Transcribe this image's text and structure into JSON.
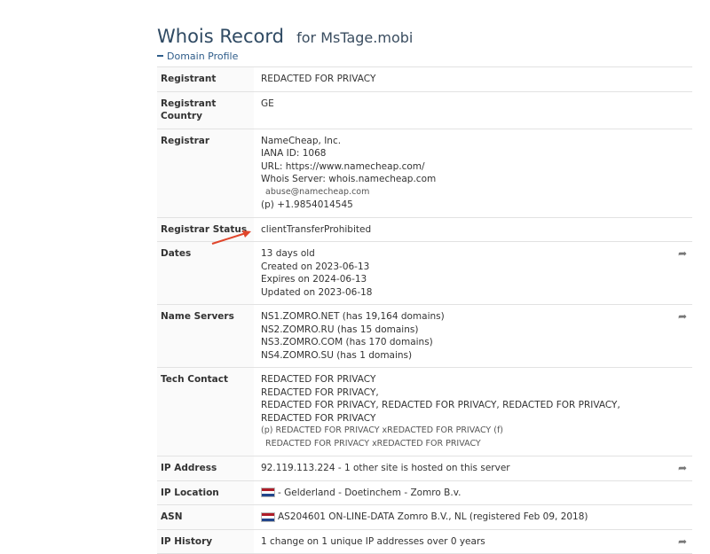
{
  "page": {
    "title": "Whois Record",
    "subtitle": "for MsTage.mobi",
    "section": "Domain Profile"
  },
  "rows": {
    "registrant": {
      "key": "Registrant",
      "value": "REDACTED FOR PRIVACY"
    },
    "registrant_country": {
      "key": "Registrant Country",
      "value": "GE"
    },
    "registrar": {
      "key": "Registrar",
      "name": "NameCheap, Inc.",
      "iana": "IANA ID: 1068",
      "url": "URL: https://www.namecheap.com/",
      "whois": "Whois Server: whois.namecheap.com",
      "email": "abuse@namecheap.com",
      "phone_label": "(p)",
      "phone": "+1.9854014545"
    },
    "registrar_status": {
      "key": "Registrar Status",
      "value": "clientTransferProhibited"
    },
    "dates": {
      "key": "Dates",
      "age": "13 days old",
      "created": "Created on 2023-06-13",
      "expires": "Expires on 2024-06-13",
      "updated": "Updated on 2023-06-18"
    },
    "name_servers": {
      "key": "Name Servers",
      "ns1": "NS1.ZOMRO.NET (has 19,164 domains)",
      "ns2": "NS2.ZOMRO.RU (has 15 domains)",
      "ns3": "NS3.ZOMRO.COM (has 170 domains)",
      "ns4": "NS4.ZOMRO.SU (has 1 domains)"
    },
    "tech_contact": {
      "key": "Tech Contact",
      "l1": "REDACTED FOR PRIVACY",
      "l2": "REDACTED FOR PRIVACY,",
      "l3": "REDACTED FOR PRIVACY, REDACTED FOR PRIVACY, REDACTED FOR PRIVACY, REDACTED FOR PRIVACY",
      "phone_label": "(p)",
      "phone": "REDACTED FOR PRIVACY xREDACTED FOR PRIVACY",
      "fax_label": "(f)",
      "email": "REDACTED FOR PRIVACY xREDACTED FOR PRIVACY"
    },
    "ip_address": {
      "key": "IP Address",
      "value": "92.119.113.224 - 1 other site is hosted on this server"
    },
    "ip_location": {
      "key": "IP Location",
      "value": "- Gelderland - Doetinchem - Zomro B.v."
    },
    "asn": {
      "key": "ASN",
      "value": "AS204601 ON-LINE-DATA Zomro B.V., NL (registered Feb 09, 2018)"
    },
    "ip_history": {
      "key": "IP History",
      "value": "1 change on 1 unique IP addresses over 0 years"
    }
  },
  "icons": {
    "share": "share-arrow-icon",
    "flag": "netherlands-flag-icon",
    "annotation": "red-arrow-annotation"
  },
  "colors": {
    "title": "#2f4a63",
    "link": "#2f5d8a",
    "annotation": "#e0452b"
  }
}
